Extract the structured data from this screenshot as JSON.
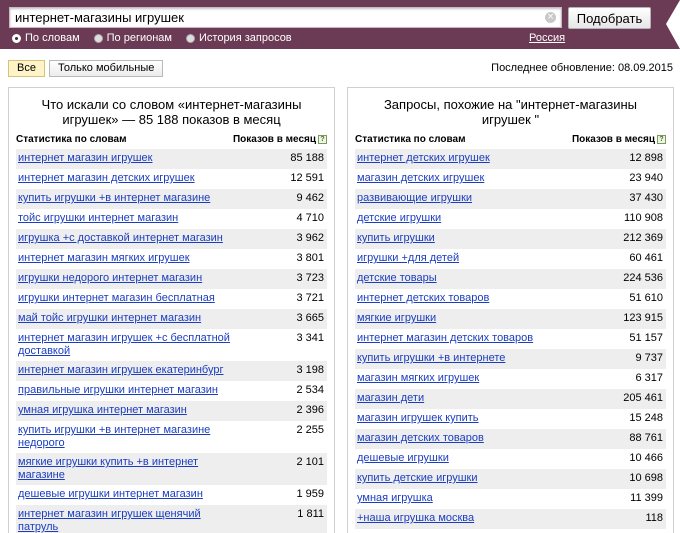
{
  "search": {
    "query": "интернет-магазины игрушек",
    "submit_label": "Подобрать",
    "clear_glyph": "×"
  },
  "modes": [
    {
      "label": "По словам",
      "selected": true
    },
    {
      "label": "По регионам",
      "selected": false
    },
    {
      "label": "История запросов",
      "selected": false
    }
  ],
  "region": "Россия",
  "filters": [
    {
      "label": "Все",
      "active": true
    },
    {
      "label": "Только мобильные",
      "active": false
    }
  ],
  "last_update": "Последнее обновление: 08.09.2015",
  "left_panel": {
    "title": "Что искали со словом «интернет-магазины игрушек» — 85 188 показов в месяц",
    "col_phrase": "Статистика по словам",
    "col_count": "Показов в месяц",
    "help_glyph": "?",
    "rows": [
      {
        "phrase": "интернет магазин игрушек",
        "count": "85 188"
      },
      {
        "phrase": "интернет магазин детских игрушек",
        "count": "12 591"
      },
      {
        "phrase": "купить игрушки +в интернет магазине",
        "count": "9 462"
      },
      {
        "phrase": "тойс игрушки интернет магазин",
        "count": "4 710"
      },
      {
        "phrase": "игрушка +с доставкой интернет магазин",
        "count": "3 962"
      },
      {
        "phrase": "интернет магазин мягких игрушек",
        "count": "3 801"
      },
      {
        "phrase": "игрушки недорого интернет магазин",
        "count": "3 723"
      },
      {
        "phrase": "игрушки интернет магазин бесплатная",
        "count": "3 721"
      },
      {
        "phrase": "май тойс игрушки интернет магазин",
        "count": "3 665"
      },
      {
        "phrase": "интернет магазин игрушек +с бесплатной доставкой",
        "count": "3 341"
      },
      {
        "phrase": "интернет магазин игрушек екатеринбург",
        "count": "3 198"
      },
      {
        "phrase": "правильные игрушки интернет магазин",
        "count": "2 534"
      },
      {
        "phrase": "умная игрушка интернет магазин",
        "count": "2 396"
      },
      {
        "phrase": "купить игрушки +в интернет магазине недорого",
        "count": "2 255"
      },
      {
        "phrase": "мягкие игрушки купить +в интернет магазине",
        "count": "2 101"
      },
      {
        "phrase": "дешевые игрушки интернет магазин",
        "count": "1 959"
      },
      {
        "phrase": "интернет магазин игрушек щенячий патруль",
        "count": "1 811"
      }
    ]
  },
  "right_panel": {
    "title": "Запросы, похожие на \"интернет-магазины игрушек \"",
    "col_phrase": "Статистика по словам",
    "col_count": "Показов в месяц",
    "help_glyph": "?",
    "rows": [
      {
        "phrase": "интернет детских игрушек",
        "count": "12 898"
      },
      {
        "phrase": "магазин детских игрушек",
        "count": "23 940"
      },
      {
        "phrase": "развивающие игрушки",
        "count": "37 430"
      },
      {
        "phrase": "детские игрушки",
        "count": "110 908"
      },
      {
        "phrase": "купить игрушки",
        "count": "212 369"
      },
      {
        "phrase": "игрушки +для детей",
        "count": "60 461"
      },
      {
        "phrase": "детские товары",
        "count": "224 536"
      },
      {
        "phrase": "интернет детских товаров",
        "count": "51 610"
      },
      {
        "phrase": "мягкие игрушки",
        "count": "123 915"
      },
      {
        "phrase": "интернет магазин детских товаров",
        "count": "51 157"
      },
      {
        "phrase": "купить игрушки +в интернете",
        "count": "9 737"
      },
      {
        "phrase": "магазин мягких игрушек",
        "count": "6 317"
      },
      {
        "phrase": "магазин дети",
        "count": "205 461"
      },
      {
        "phrase": "магазин игрушек купить",
        "count": "15 248"
      },
      {
        "phrase": "магазин детских товаров",
        "count": "88 761"
      },
      {
        "phrase": "дешевые игрушки",
        "count": "10 466"
      },
      {
        "phrase": "купить детские игрушки",
        "count": "10 698"
      },
      {
        "phrase": "умная игрушка",
        "count": "11 399"
      },
      {
        "phrase": "+наша игрушка москва",
        "count": "118"
      }
    ]
  }
}
